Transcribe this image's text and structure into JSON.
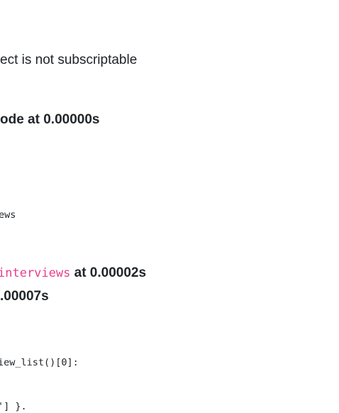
{
  "error_message": "ect is not subscriptable",
  "heading_1": "ode at 0.00000s",
  "code_fragment_1": "ews",
  "heading_2": {
    "code": "interviews",
    "text": " at 0.00002s"
  },
  "heading_3": ".00007s",
  "code_fragment_2": "iew_list()[0]:",
  "code_fragment_3": "'] }."
}
